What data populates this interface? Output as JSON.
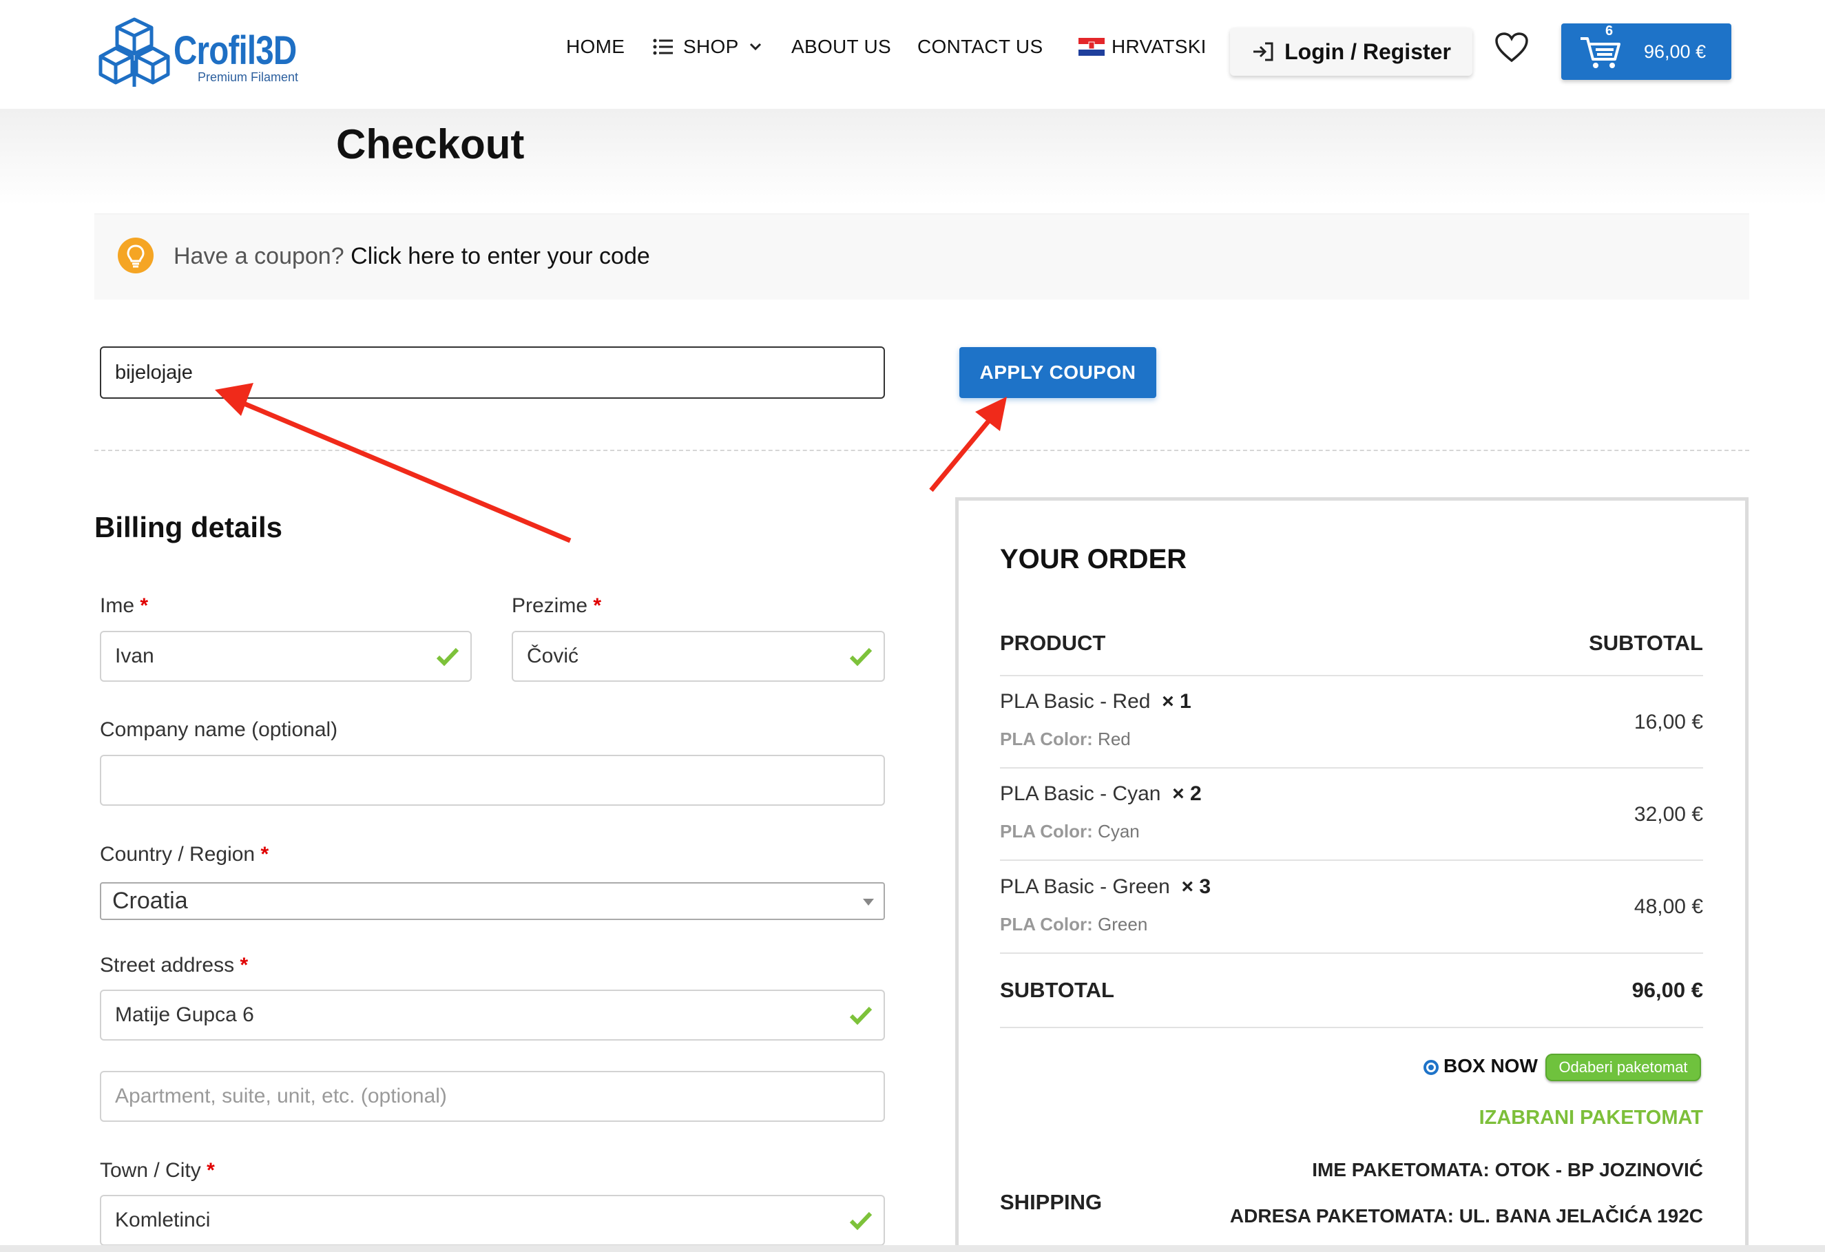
{
  "brand": {
    "name": "Crofil3D",
    "tagline": "Premium Filament"
  },
  "nav": {
    "home": "HOME",
    "shop": "SHOP",
    "about": "ABOUT US",
    "contact": "CONTACT US",
    "language": "HRVATSKI",
    "login": "Login / Register",
    "cart_count": "6",
    "cart_total": "96,00 €"
  },
  "page_title": "Checkout",
  "coupon": {
    "question": "Have a coupon?",
    "link": "Click here to enter your code",
    "code_value": "bijelojaje",
    "apply_label": "APPLY COUPON"
  },
  "billing": {
    "title": "Billing details",
    "first_name_label": "Ime",
    "first_name": "Ivan",
    "last_name_label": "Prezime",
    "last_name": "Čović",
    "company_label": "Company name (optional)",
    "company": "",
    "country_label": "Country / Region",
    "country": "Croatia",
    "street_label": "Street address",
    "street": "Matije Gupca 6",
    "apartment_placeholder": "Apartment, suite, unit, etc. (optional)",
    "city_label": "Town / City",
    "city": "Komletinci",
    "required_mark": "*"
  },
  "order": {
    "title": "YOUR ORDER",
    "col_product": "PRODUCT",
    "col_subtotal": "SUBTOTAL",
    "items": [
      {
        "name": "PLA Basic - Red",
        "qty": "× 1",
        "meta_label": "PLA Color:",
        "meta_value": "Red",
        "price": "16,00 €"
      },
      {
        "name": "PLA Basic - Cyan",
        "qty": "× 2",
        "meta_label": "PLA Color:",
        "meta_value": "Cyan",
        "price": "32,00 €"
      },
      {
        "name": "PLA Basic - Green",
        "qty": "× 3",
        "meta_label": "PLA Color:",
        "meta_value": "Green",
        "price": "48,00 €"
      }
    ],
    "subtotal_label": "SUBTOTAL",
    "subtotal_value": "96,00 €",
    "shipping_label": "SHIPPING",
    "box_now": "BOX NOW",
    "paketomat_button": "Odaberi paketomat",
    "izabrani": "IZABRANI PAKETOMAT",
    "paketomat_name": "IME PAKETOMATA: OTOK - BP JOZINOVIĆ",
    "paketomat_address": "ADRESA PAKETOMATA: UL. BANA JELAČIĆA 192C"
  },
  "colors": {
    "accent": "#1e73c8",
    "required": "#e00000",
    "success": "#7dbf3a",
    "arrow": "#f02a1a"
  },
  "icons": [
    "logo-cube-icon",
    "menu-list-icon",
    "chevron-down-icon",
    "croatia-flag-icon",
    "login-icon",
    "heart-icon",
    "cart-icon",
    "lightbulb-icon",
    "checkmark-icon",
    "select-caret-icon",
    "annotation-arrow"
  ]
}
